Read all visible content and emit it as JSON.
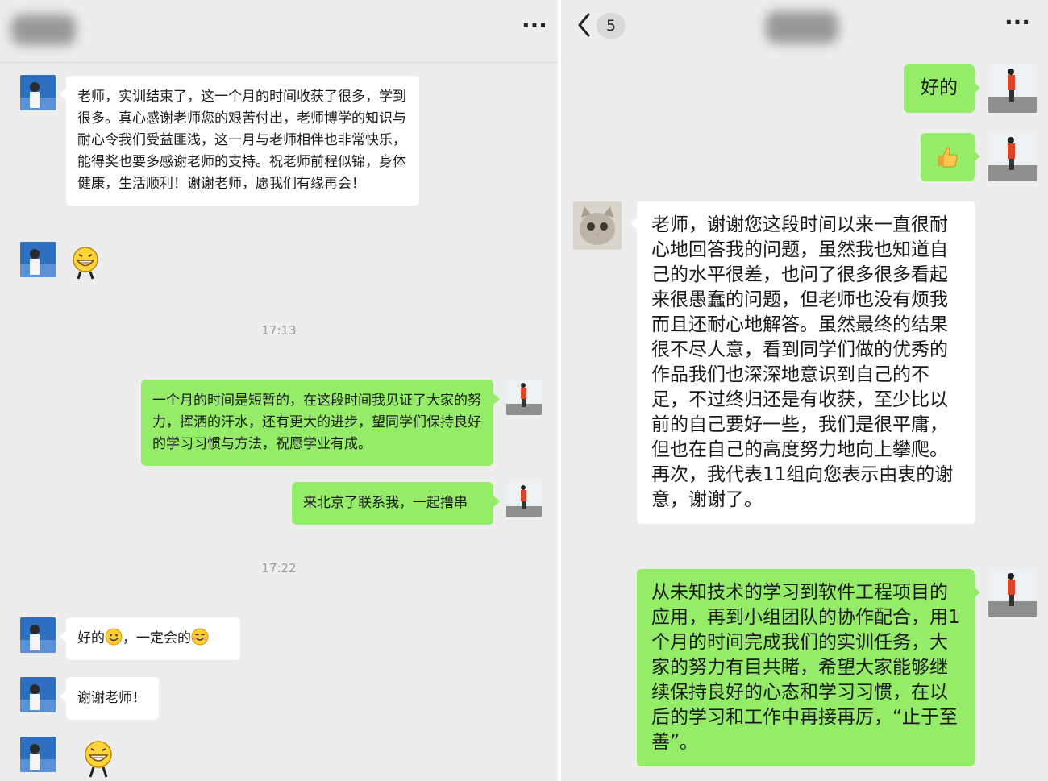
{
  "left_chat": {
    "timestamps": [
      "17:13",
      "17:22"
    ],
    "messages": [
      {
        "sender": "other",
        "text": "老师，实训结束了，这一个月的时间收获了很多，学到很多。真心感谢老师您的艰苦付出，老师博学的知识与耐心令我们受益匪浅，这一月与老师相伴也非常快乐，能得奖也要多感谢老师的支持。祝老师前程似锦，身体健康，生活顺利！谢谢老师，愿我们有缘再会！"
      },
      {
        "sender": "me",
        "text": "一个月的时间是短暂的，在这段时间我见证了大家的努力，挥洒的汗水，还有更大的进步，望同学们保持良好的学习习惯与方法，祝愿学业有成。"
      },
      {
        "sender": "me",
        "text": "来北京了联系我，一起撸串"
      },
      {
        "sender": "other",
        "text_before": "好的",
        "text_middle": "，一定会的"
      },
      {
        "sender": "other",
        "text": "谢谢老师！"
      }
    ]
  },
  "right_chat": {
    "back_count": "5",
    "messages": [
      {
        "sender": "me",
        "text": "好的"
      },
      {
        "sender": "me",
        "sticker": "thumbs-up"
      },
      {
        "sender": "other",
        "text": "老师，谢谢您这段时间以来一直很耐心地回答我的问题，虽然我也知道自己的水平很差，也问了很多很多看起来很愚蠢的问题，但老师也没有烦我而且还耐心地解答。虽然最终的结果很不尽人意，看到同学们做的优秀的作品我们也深深地意识到自己的不足，不过终归还是有收获，至少比以前的自己要好一些，我们是很平庸，但也在自己的高度努力地向上攀爬。再次，我代表11组向您表示由衷的谢意，谢谢了。"
      },
      {
        "sender": "me",
        "text": "从未知技术的学习到软件工程项目的应用，再到小组团队的协作配合，用1个月的时间完成我们的实训任务，大家的努力有目共睹，希望大家能够继续保持良好的心态和学习习惯，在以后的学习和工作中再接再厉，“止于至善”。"
      }
    ]
  },
  "colors": {
    "chat_background": "#ededed",
    "bubble_green": "#95ec69",
    "bubble_white": "#ffffff",
    "timestamp_gray": "#9b9b9b"
  },
  "icons": [
    "more-icon",
    "back-chevron-icon",
    "thumbs-up-icon",
    "grin-sticker",
    "smile-emoji",
    "blush-emoji"
  ]
}
